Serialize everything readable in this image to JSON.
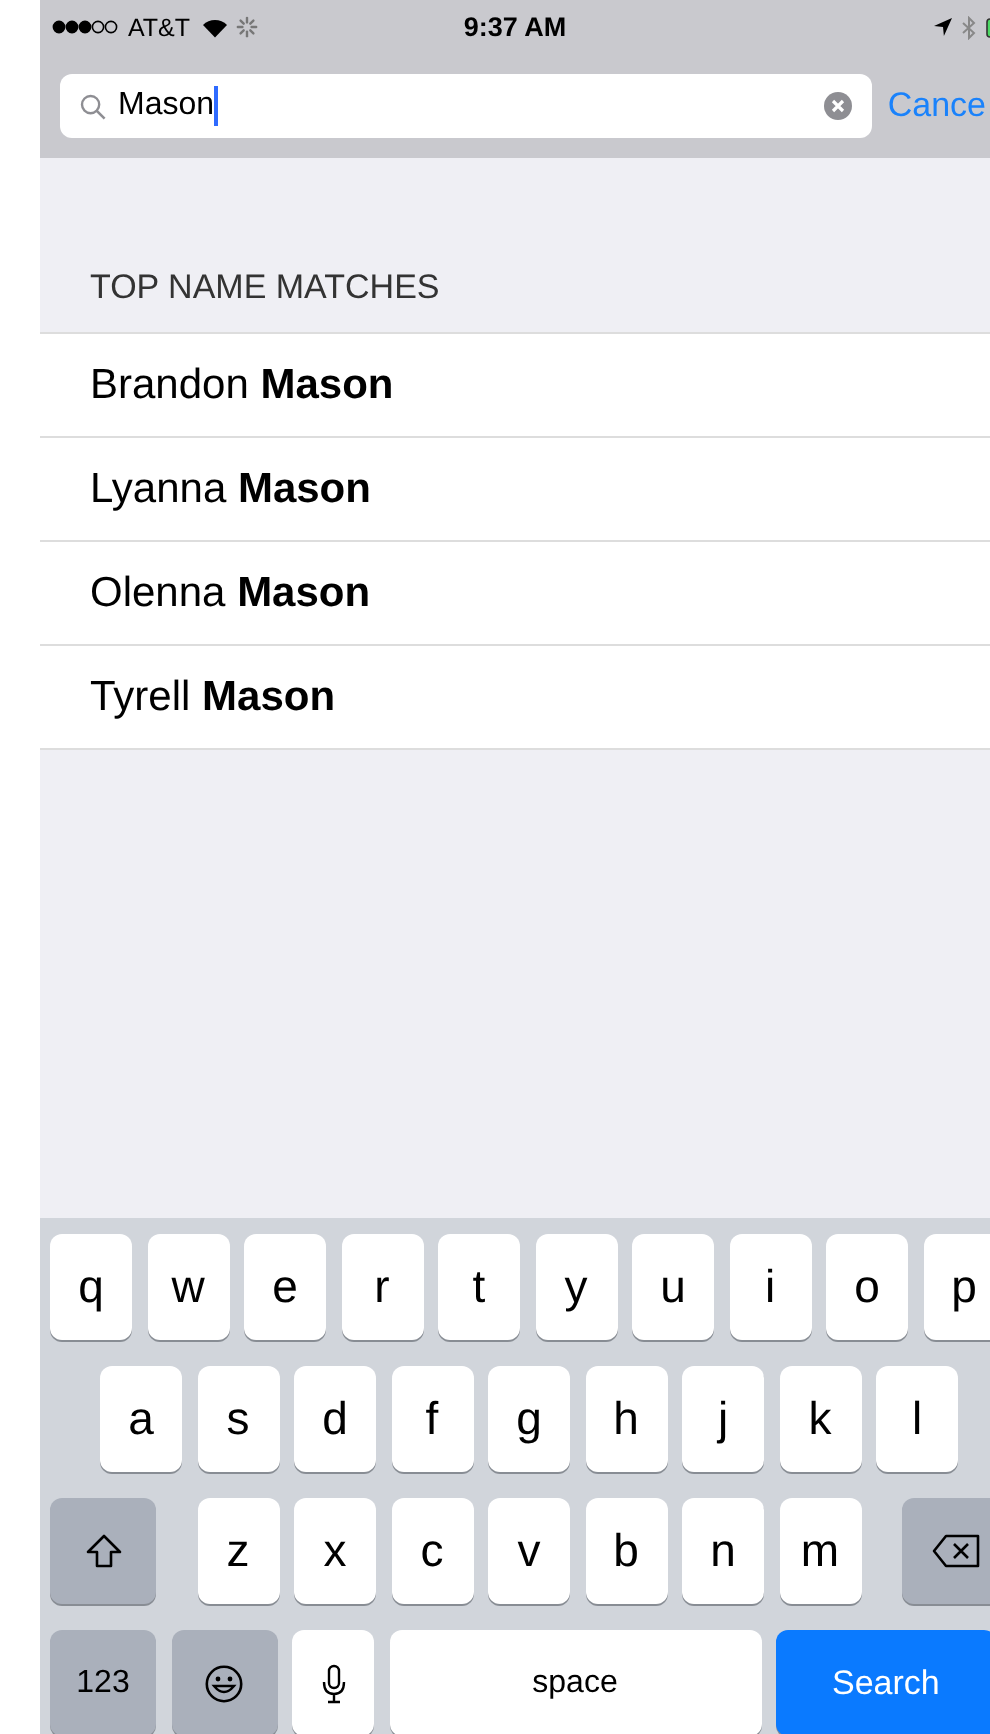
{
  "status_bar": {
    "carrier": "AT&T",
    "time": "9:37 AM"
  },
  "search": {
    "value": "Mason",
    "cancel": "Cance"
  },
  "section_header": "TOP NAME MATCHES",
  "results": [
    {
      "name": "Brandon **Mason**"
    },
    {
      "name": "Lyanna **Mason**"
    },
    {
      "name": "Olenna **Mason**"
    },
    {
      "name": "Tyrell **Mason**"
    }
  ],
  "keyboard": {
    "letter_rows": [
      [
        {
          "kind": "letter",
          "label": "q"
        },
        {
          "kind": "letter",
          "label": "w"
        },
        {
          "kind": "letter",
          "label": "e"
        },
        {
          "kind": "letter",
          "label": "r"
        },
        {
          "kind": "letter",
          "label": "t"
        },
        {
          "kind": "letter",
          "label": "y"
        },
        {
          "kind": "letter",
          "label": "u"
        },
        {
          "kind": "letter",
          "label": "i"
        },
        {
          "kind": "letter",
          "label": "o"
        },
        {
          "kind": "letter",
          "label": "p"
        }
      ],
      [
        {
          "kind": "letter",
          "label": "a"
        },
        {
          "kind": "letter",
          "label": "s"
        },
        {
          "kind": "letter",
          "label": "d"
        },
        {
          "kind": "letter",
          "label": "f"
        },
        {
          "kind": "letter",
          "label": "g"
        },
        {
          "kind": "letter",
          "label": "h"
        },
        {
          "kind": "letter",
          "label": "j"
        },
        {
          "kind": "letter",
          "label": "k"
        },
        {
          "kind": "letter",
          "label": "l"
        }
      ],
      [
        {
          "kind": "shift"
        },
        {
          "kind": "letter",
          "label": "z"
        },
        {
          "kind": "letter",
          "label": "x"
        },
        {
          "kind": "letter",
          "label": "c"
        },
        {
          "kind": "letter",
          "label": "v"
        },
        {
          "kind": "letter",
          "label": "b"
        },
        {
          "kind": "letter",
          "label": "n"
        },
        {
          "kind": "letter",
          "label": "m"
        },
        {
          "kind": "delete"
        }
      ]
    ],
    "bottom_bar": [
      {
        "kind": "mode",
        "label": "123"
      },
      {
        "kind": "emoji"
      },
      {
        "kind": "mic"
      },
      {
        "kind": "space",
        "label": "space"
      },
      {
        "kind": "action",
        "label": "Search"
      }
    ]
  }
}
